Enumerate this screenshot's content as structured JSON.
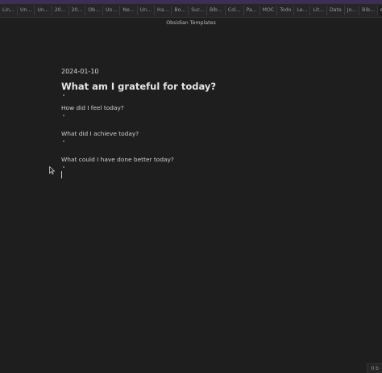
{
  "tabs": [
    "Lin...",
    "Un...",
    "Un...",
    "20...",
    "20...",
    "Ob...",
    "Un...",
    "Ne...",
    "Un...",
    "Ha...",
    "Bo...",
    "Sur...",
    "Bib...",
    "Col...",
    "Pa...",
    "MOC",
    "Todo",
    "Le...",
    "Lit...",
    "Date",
    "Jo...",
    "Bib...",
    "o"
  ],
  "window_title": "Obsidian Templates",
  "note": {
    "date": "2024-01-10",
    "heading": "What am I grateful for today?",
    "questions": [
      "How did I feel today?",
      "What did I achieve today?",
      "What could I have done better today?"
    ]
  },
  "status": {
    "text": "0 b"
  },
  "colors": {
    "background": "#1e1e1e",
    "accent": "#3b2f55"
  }
}
